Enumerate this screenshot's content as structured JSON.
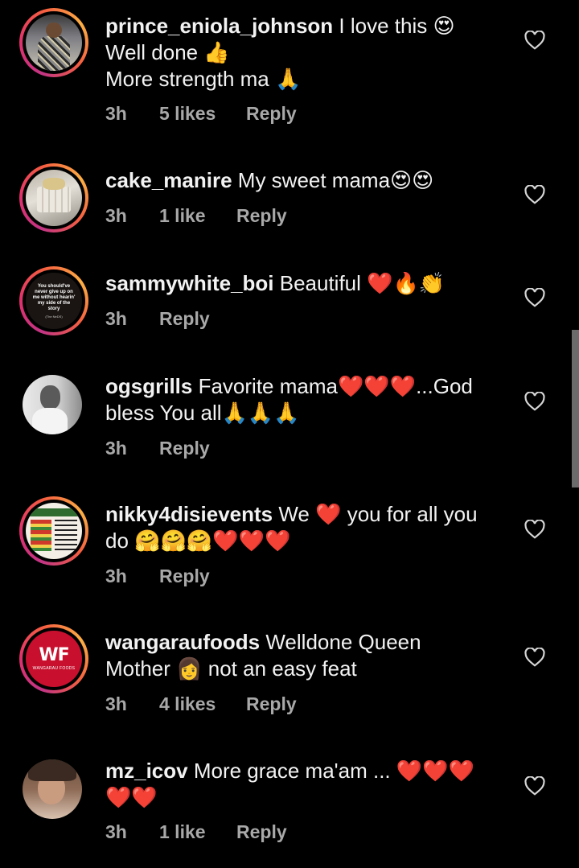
{
  "comments": [
    {
      "username": "prince_eniola_johnson",
      "text_line1": " I love this 😍",
      "text_line2": "Well done 👍",
      "text_line3": "More strength ma 🙏",
      "time": "3h",
      "likes": "5 likes",
      "reply": "Reply"
    },
    {
      "username": "cake_manire",
      "text_line1": " My sweet mama😍😍",
      "time": "3h",
      "likes": "1 like",
      "reply": "Reply"
    },
    {
      "username": "sammywhite_boi",
      "text_line1": " Beautiful ❤️🔥👏",
      "avatar_text": "You should've never give up on me without hearin' my side of the story",
      "avatar_sub": "(The NeDS)",
      "time": "3h",
      "reply": "Reply"
    },
    {
      "username": "ogsgrills",
      "text_line1": " Favorite mama❤️❤️❤️...God",
      "text_line2": "bless You all🙏🙏🙏",
      "time": "3h",
      "reply": "Reply"
    },
    {
      "username": "nikky4disievents",
      "text_line1": " We ❤️ you for all you",
      "text_line2": "do 🤗🤗🤗❤️❤️❤️",
      "time": "3h",
      "reply": "Reply"
    },
    {
      "username": "wangaraufoods",
      "text_line1": " Welldone Queen",
      "text_line2": "Mother 👩 not an easy feat",
      "avatar_brand": "WANGARAU FOODS",
      "time": "3h",
      "likes": "4 likes",
      "reply": "Reply"
    },
    {
      "username": "mz_icov",
      "text_line1": " More grace ma'am ... ❤️❤️❤️",
      "text_line2": "❤️❤️",
      "time": "3h",
      "likes": "1 like",
      "reply": "Reply"
    }
  ],
  "colors": {
    "background": "#000000",
    "text": "#f2f2f2",
    "meta": "#a8a8a8",
    "ring_gradient": [
      "#c13584",
      "#e1306c",
      "#f56040",
      "#fcaf45"
    ]
  }
}
